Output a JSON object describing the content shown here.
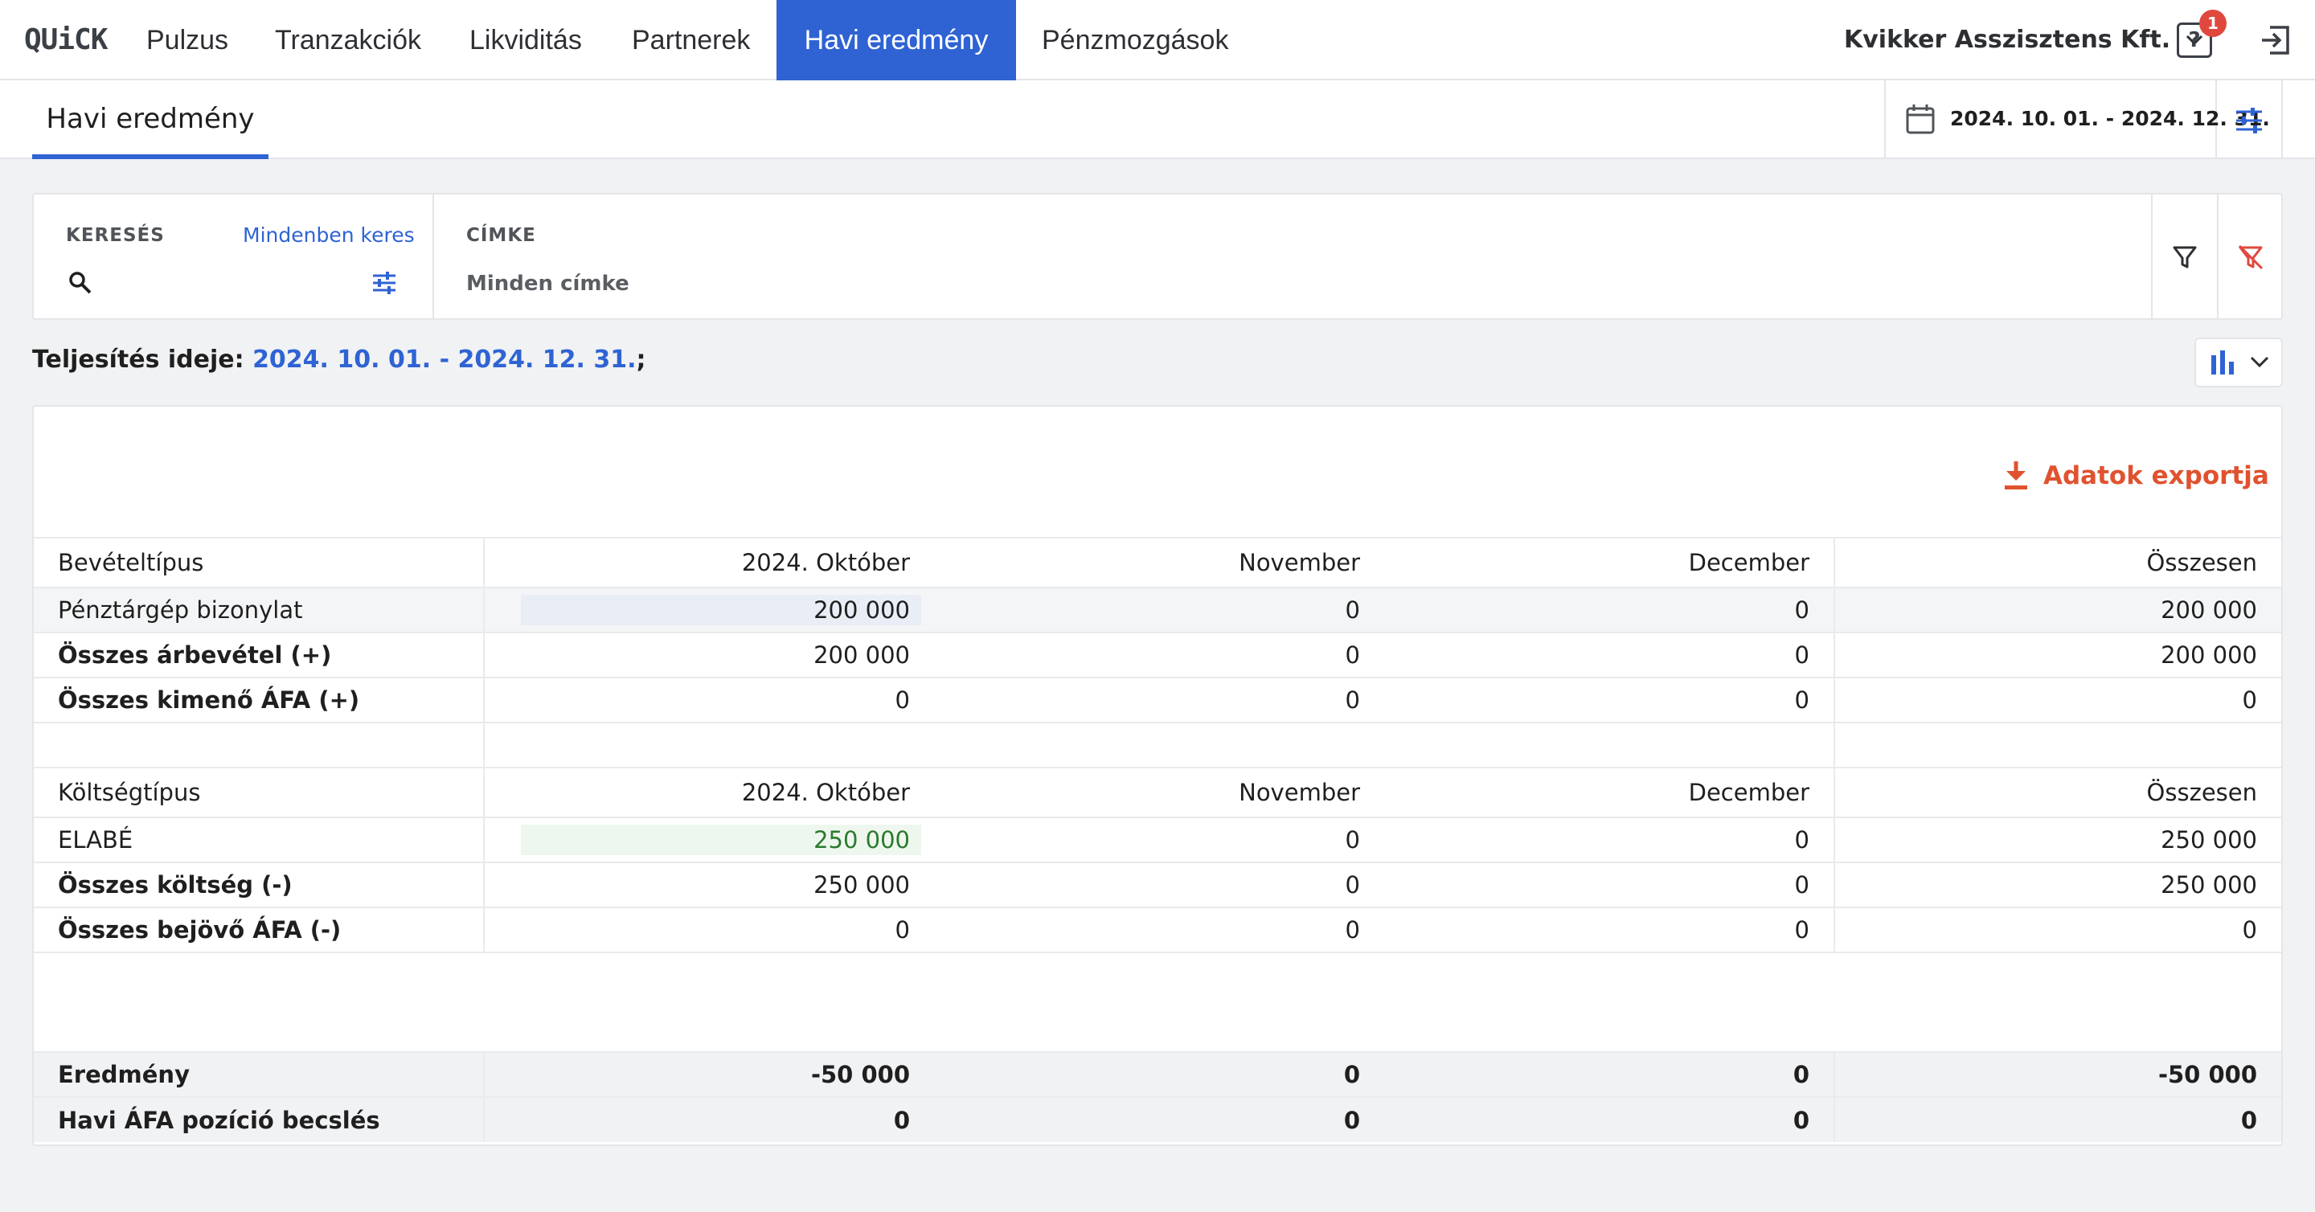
{
  "nav": {
    "logo": "QUiCK",
    "items": [
      {
        "label": "Pulzus",
        "active": false
      },
      {
        "label": "Tranzakciók",
        "active": false
      },
      {
        "label": "Likviditás",
        "active": false
      },
      {
        "label": "Partnerek",
        "active": false
      },
      {
        "label": "Havi eredmény",
        "active": true
      },
      {
        "label": "Pénzmozgások",
        "active": false
      }
    ],
    "company": "Kvikker Asszisztens Kft.",
    "help_badge": "1",
    "accent": "#2f63d3",
    "icons": [
      "help-icon",
      "logout-icon",
      "chevron-down-icon"
    ]
  },
  "subheader": {
    "page_tab": "Havi eredmény",
    "date_range": "2024. 10. 01. - 2024. 12. 31.",
    "icons": [
      "calendar-icon",
      "tune-icon"
    ]
  },
  "filters": {
    "search_label": "KERESÉS",
    "search_link": "Mindenben keres",
    "search_value": "",
    "tag_label": "CÍMKE",
    "tag_value": "Minden címke",
    "icons": [
      "search-icon",
      "tune-icon",
      "filter-icon",
      "filter-clear-icon"
    ]
  },
  "info": {
    "prefix": "Teljesítés ideje:",
    "range": "2024. 10. 01. - 2024. 12. 31.",
    "suffix": ";"
  },
  "report": {
    "export_label": "Adatok exportja",
    "export_color": "#e0522f",
    "income": {
      "header": [
        "Bevételtípus",
        "2024. Október",
        "November",
        "December",
        "Összesen"
      ],
      "rows": [
        {
          "label": "Pénztárgép bizonylat",
          "values": [
            "200 000",
            "0",
            "0",
            "200 000"
          ]
        },
        {
          "label": "Összes árbevétel (+)",
          "values": [
            "200 000",
            "0",
            "0",
            "200 000"
          ]
        },
        {
          "label": "Összes kimenő ÁFA (+)",
          "values": [
            "0",
            "0",
            "0",
            "0"
          ]
        }
      ]
    },
    "cost": {
      "header": [
        "Költségtípus",
        "2024. Október",
        "November",
        "December",
        "Összesen"
      ],
      "rows": [
        {
          "label": "ELABÉ",
          "values": [
            "250 000",
            "0",
            "0",
            "250 000"
          ]
        },
        {
          "label": "Összes költség (-)",
          "values": [
            "250 000",
            "0",
            "0",
            "250 000"
          ]
        },
        {
          "label": "Összes bejövő ÁFA (-)",
          "values": [
            "0",
            "0",
            "0",
            "0"
          ]
        }
      ]
    },
    "result": {
      "rows": [
        {
          "label": "Eredmény",
          "values": [
            "-50 000",
            "0",
            "0",
            "-50 000"
          ]
        },
        {
          "label": "Havi ÁFA pozíció becslés",
          "values": [
            "0",
            "0",
            "0",
            "0"
          ]
        }
      ]
    }
  }
}
